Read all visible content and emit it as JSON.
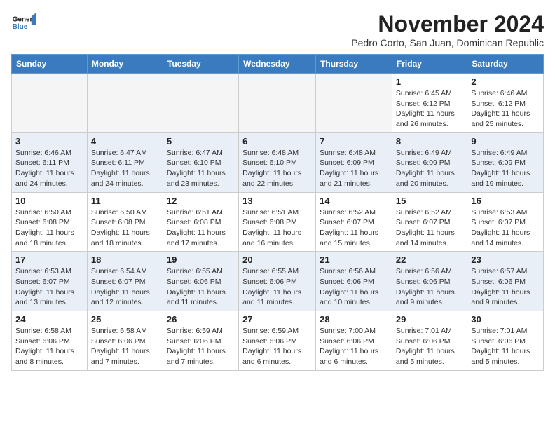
{
  "logo": {
    "line1": "General",
    "line2": "Blue"
  },
  "title": "November 2024",
  "location": "Pedro Corto, San Juan, Dominican Republic",
  "days_of_week": [
    "Sunday",
    "Monday",
    "Tuesday",
    "Wednesday",
    "Thursday",
    "Friday",
    "Saturday"
  ],
  "weeks": [
    [
      {
        "day": "",
        "info": ""
      },
      {
        "day": "",
        "info": ""
      },
      {
        "day": "",
        "info": ""
      },
      {
        "day": "",
        "info": ""
      },
      {
        "day": "",
        "info": ""
      },
      {
        "day": "1",
        "info": "Sunrise: 6:45 AM\nSunset: 6:12 PM\nDaylight: 11 hours and 26 minutes."
      },
      {
        "day": "2",
        "info": "Sunrise: 6:46 AM\nSunset: 6:12 PM\nDaylight: 11 hours and 25 minutes."
      }
    ],
    [
      {
        "day": "3",
        "info": "Sunrise: 6:46 AM\nSunset: 6:11 PM\nDaylight: 11 hours and 24 minutes."
      },
      {
        "day": "4",
        "info": "Sunrise: 6:47 AM\nSunset: 6:11 PM\nDaylight: 11 hours and 24 minutes."
      },
      {
        "day": "5",
        "info": "Sunrise: 6:47 AM\nSunset: 6:10 PM\nDaylight: 11 hours and 23 minutes."
      },
      {
        "day": "6",
        "info": "Sunrise: 6:48 AM\nSunset: 6:10 PM\nDaylight: 11 hours and 22 minutes."
      },
      {
        "day": "7",
        "info": "Sunrise: 6:48 AM\nSunset: 6:09 PM\nDaylight: 11 hours and 21 minutes."
      },
      {
        "day": "8",
        "info": "Sunrise: 6:49 AM\nSunset: 6:09 PM\nDaylight: 11 hours and 20 minutes."
      },
      {
        "day": "9",
        "info": "Sunrise: 6:49 AM\nSunset: 6:09 PM\nDaylight: 11 hours and 19 minutes."
      }
    ],
    [
      {
        "day": "10",
        "info": "Sunrise: 6:50 AM\nSunset: 6:08 PM\nDaylight: 11 hours and 18 minutes."
      },
      {
        "day": "11",
        "info": "Sunrise: 6:50 AM\nSunset: 6:08 PM\nDaylight: 11 hours and 18 minutes."
      },
      {
        "day": "12",
        "info": "Sunrise: 6:51 AM\nSunset: 6:08 PM\nDaylight: 11 hours and 17 minutes."
      },
      {
        "day": "13",
        "info": "Sunrise: 6:51 AM\nSunset: 6:08 PM\nDaylight: 11 hours and 16 minutes."
      },
      {
        "day": "14",
        "info": "Sunrise: 6:52 AM\nSunset: 6:07 PM\nDaylight: 11 hours and 15 minutes."
      },
      {
        "day": "15",
        "info": "Sunrise: 6:52 AM\nSunset: 6:07 PM\nDaylight: 11 hours and 14 minutes."
      },
      {
        "day": "16",
        "info": "Sunrise: 6:53 AM\nSunset: 6:07 PM\nDaylight: 11 hours and 14 minutes."
      }
    ],
    [
      {
        "day": "17",
        "info": "Sunrise: 6:53 AM\nSunset: 6:07 PM\nDaylight: 11 hours and 13 minutes."
      },
      {
        "day": "18",
        "info": "Sunrise: 6:54 AM\nSunset: 6:07 PM\nDaylight: 11 hours and 12 minutes."
      },
      {
        "day": "19",
        "info": "Sunrise: 6:55 AM\nSunset: 6:06 PM\nDaylight: 11 hours and 11 minutes."
      },
      {
        "day": "20",
        "info": "Sunrise: 6:55 AM\nSunset: 6:06 PM\nDaylight: 11 hours and 11 minutes."
      },
      {
        "day": "21",
        "info": "Sunrise: 6:56 AM\nSunset: 6:06 PM\nDaylight: 11 hours and 10 minutes."
      },
      {
        "day": "22",
        "info": "Sunrise: 6:56 AM\nSunset: 6:06 PM\nDaylight: 11 hours and 9 minutes."
      },
      {
        "day": "23",
        "info": "Sunrise: 6:57 AM\nSunset: 6:06 PM\nDaylight: 11 hours and 9 minutes."
      }
    ],
    [
      {
        "day": "24",
        "info": "Sunrise: 6:58 AM\nSunset: 6:06 PM\nDaylight: 11 hours and 8 minutes."
      },
      {
        "day": "25",
        "info": "Sunrise: 6:58 AM\nSunset: 6:06 PM\nDaylight: 11 hours and 7 minutes."
      },
      {
        "day": "26",
        "info": "Sunrise: 6:59 AM\nSunset: 6:06 PM\nDaylight: 11 hours and 7 minutes."
      },
      {
        "day": "27",
        "info": "Sunrise: 6:59 AM\nSunset: 6:06 PM\nDaylight: 11 hours and 6 minutes."
      },
      {
        "day": "28",
        "info": "Sunrise: 7:00 AM\nSunset: 6:06 PM\nDaylight: 11 hours and 6 minutes."
      },
      {
        "day": "29",
        "info": "Sunrise: 7:01 AM\nSunset: 6:06 PM\nDaylight: 11 hours and 5 minutes."
      },
      {
        "day": "30",
        "info": "Sunrise: 7:01 AM\nSunset: 6:06 PM\nDaylight: 11 hours and 5 minutes."
      }
    ]
  ]
}
